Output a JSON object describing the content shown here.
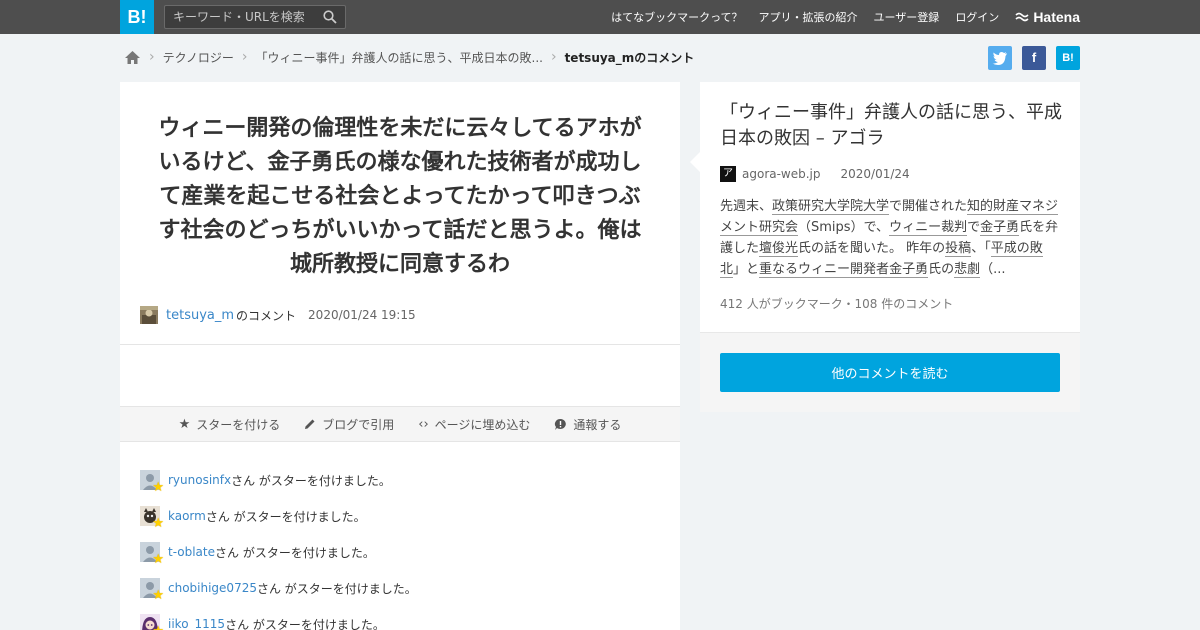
{
  "topbar": {
    "logo": "B!",
    "search_placeholder": "キーワード・URLを検索",
    "nav": [
      "はてなブックマークって？",
      "アプリ・拡張の紹介",
      "ユーザー登録",
      "ログイン"
    ],
    "brand": "Hatena"
  },
  "breadcrumb": {
    "category": "テクノロジー",
    "entry": "「ウィニー事件」弁護人の話に思う、平成日本の敗...",
    "current": "tetsuya_mのコメント"
  },
  "share": {
    "twitter": "t",
    "facebook": "f",
    "hatebu": "B!"
  },
  "comment": {
    "text": "ウィニー開発の倫理性を未だに云々してるアホがいるけど、金子勇氏の様な優れた技術者が成功して産業を起こせる社会とよってたかって叩きつぶす社会のどっちがいいかって話だと思うよ。俺は城所教授に同意するわ",
    "user": "tetsuya_m",
    "suffix": "のコメント",
    "timestamp": "2020/01/24 19:15"
  },
  "actions": {
    "star": "スターを付ける",
    "blog": "ブログで引用",
    "embed": "ページに埋め込む",
    "report": "通報する"
  },
  "stars": [
    {
      "user": "ryunosinfx",
      "msg": "さん がスターを付けました。"
    },
    {
      "user": "kaorm",
      "msg": "さん がスターを付けました。"
    },
    {
      "user": "t-oblate",
      "msg": "さん がスターを付けました。"
    },
    {
      "user": "chobihige0725",
      "msg": "さん がスターを付けました。"
    },
    {
      "user": "iiko_1115",
      "msg": "さん がスターを付けました。"
    }
  ],
  "entry": {
    "title": "「ウィニー事件」弁護人の話に思う、平成日本の敗因 – アゴラ",
    "favicon": "ア",
    "domain": "agora-web.jp",
    "date": "2020/01/24",
    "summary": {
      "p1": "先週末、",
      "k1": "政策研究大学院大学",
      "p2": "で開催された",
      "k2": "知的財産マネジメント研究会",
      "p3": "（Smips）で、",
      "k3": "ウィニー裁判",
      "p4": "で",
      "k4": "金子勇",
      "p5": "氏を弁護した",
      "k5": "壇俊光",
      "p6": "氏の話を聞いた。 昨年の",
      "k6": "投稿",
      "p7": "、「",
      "k7": "平成の敗北",
      "p8": "」と",
      "k8": "重なる",
      "k9": "ウィニー開発者",
      "k10": "金子勇",
      "p9": "氏の",
      "k11": "悲劇",
      "p10": "（..."
    },
    "counts": "412 人がブックマーク・108 件のコメント",
    "read_more": "他のコメントを読む"
  },
  "colors": {
    "accent": "#00a4de",
    "topbar": "#4e4e4e",
    "link": "#3a87c8",
    "star": "#ffd000"
  }
}
